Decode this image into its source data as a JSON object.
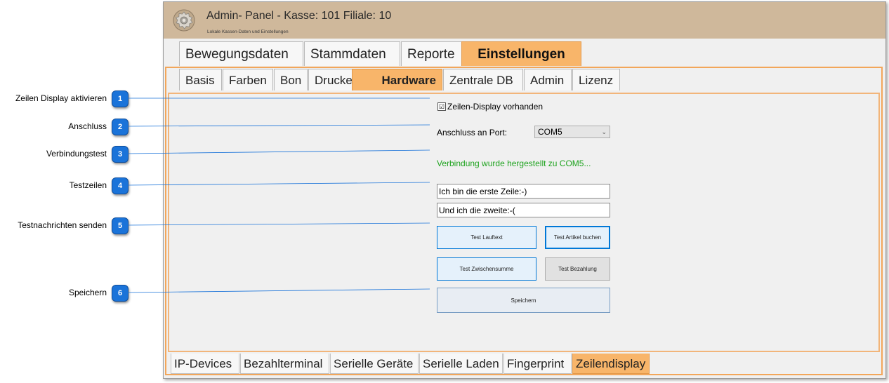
{
  "callouts": [
    {
      "num": "1",
      "label": "Zeilen Display aktivieren"
    },
    {
      "num": "2",
      "label": "Anschluss"
    },
    {
      "num": "3",
      "label": "Verbindungstest"
    },
    {
      "num": "4",
      "label": "Testzeilen"
    },
    {
      "num": "5",
      "label": "Testnachrichten senden"
    },
    {
      "num": "6",
      "label": "Speichern"
    }
  ],
  "window": {
    "title": "Admin- Panel - Kasse: 101 Filiale: 10",
    "subtitle": "Lokale Kassen-Daten und Einstellungen"
  },
  "main_tabs": [
    {
      "label": "Bewegungsdaten"
    },
    {
      "label": "Stammdaten"
    },
    {
      "label": "Reporte"
    },
    {
      "label": "Einstellungen",
      "active": true
    }
  ],
  "settings_tabs": [
    {
      "label": "Basis"
    },
    {
      "label": "Farben"
    },
    {
      "label": "Bon"
    },
    {
      "label": "Drucker"
    },
    {
      "label": "Hardware",
      "active": true
    },
    {
      "label": "Zentrale DB"
    },
    {
      "label": "Admin"
    },
    {
      "label": "Lizenz"
    }
  ],
  "display": {
    "checkbox_mark": "☑",
    "checkbox_label": "Zeilen-Display vorhanden",
    "port_label": "Anschluss an Port:",
    "port_value": "COM5",
    "status": "Verbindung wurde hergestellt zu COM5...",
    "line1": "Ich bin die erste Zeile:-)",
    "line2": "Und ich die zweite:-(",
    "btn_lauftext": "Test Lauftext",
    "btn_artikel": "Test Artikel buchen",
    "btn_zwischensumme": "Test Zwischensumme",
    "btn_bezahlung": "Test Bezahlung",
    "btn_speichern": "Speichern"
  },
  "hardware_tabs": [
    {
      "label": "IP-Devices"
    },
    {
      "label": "Bezahlterminal"
    },
    {
      "label": "Serielle Geräte"
    },
    {
      "label": "Serielle Laden"
    },
    {
      "label": "Fingerprint"
    },
    {
      "label": "Zeilendisplay",
      "active": true
    }
  ],
  "colors": {
    "accent": "#f8b56a",
    "badge": "#1a73d9",
    "status_green": "#1ea31e"
  }
}
